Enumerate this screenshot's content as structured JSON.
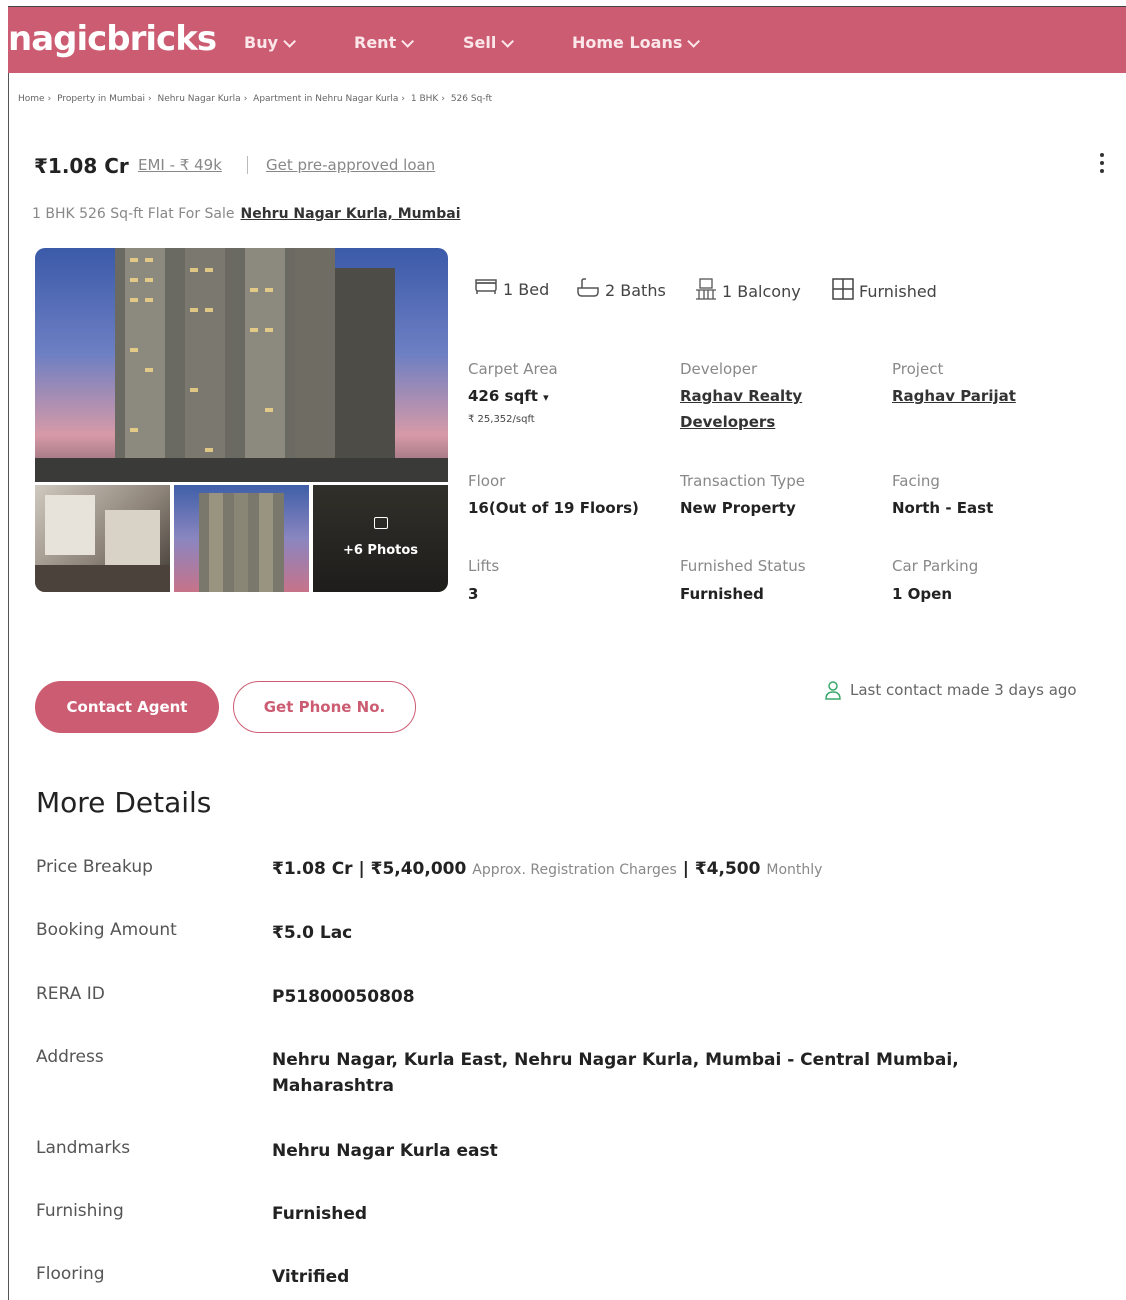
{
  "header": {
    "logo": "nagicbricks",
    "nav": [
      {
        "label": "Buy"
      },
      {
        "label": "Rent"
      },
      {
        "label": "Sell"
      },
      {
        "label": "Home Loans"
      }
    ],
    "brand_color": "#cc5c72"
  },
  "breadcrumb": [
    "Home",
    "Property in Mumbai",
    "Nehru Nagar Kurla",
    "Apartment in Nehru Nagar Kurla",
    "1 BHK",
    "526 Sq-ft"
  ],
  "listing": {
    "price": "₹1.08 Cr",
    "emi": "EMI - ₹ 49k",
    "preapproved": "Get pre-approved loan",
    "subtitle": "1 BHK 526 Sq-ft Flat For Sale",
    "location_link": "Nehru Nagar Kurla, Mumbai",
    "more_photos": "+6 Photos"
  },
  "amenities": [
    {
      "icon": "bed-icon",
      "label": "1 Bed"
    },
    {
      "icon": "bath-icon",
      "label": "2 Baths"
    },
    {
      "icon": "balcony-icon",
      "label": "1 Balcony"
    },
    {
      "icon": "furnished-icon",
      "label": "Furnished"
    }
  ],
  "specs": {
    "carpet_area": {
      "label": "Carpet Area",
      "value": "426 sqft",
      "sub": "₹ 25,352/sqft"
    },
    "developer": {
      "label": "Developer",
      "value_line1": "Raghav Realty",
      "value_line2": "Developers"
    },
    "project": {
      "label": "Project",
      "value": "Raghav Parijat"
    },
    "floor": {
      "label": "Floor",
      "value": "16(Out of 19 Floors)"
    },
    "transaction": {
      "label": "Transaction Type",
      "value": "New Property"
    },
    "facing": {
      "label": "Facing",
      "value": "North - East"
    },
    "lifts": {
      "label": "Lifts",
      "value": "3"
    },
    "furnished_status": {
      "label": "Furnished Status",
      "value": "Furnished"
    },
    "parking": {
      "label": "Car Parking",
      "value": "1 Open"
    }
  },
  "actions": {
    "contact_agent": "Contact Agent",
    "get_phone": "Get Phone No.",
    "last_contact": "Last contact made 3 days ago"
  },
  "more_details": {
    "title": "More Details",
    "price_breakup": {
      "label": "Price Breakup",
      "price": "₹1.08 Cr",
      "registration": "₹5,40,000",
      "registration_note": "Approx. Registration Charges",
      "maintenance": "₹4,500",
      "maintenance_note": "Monthly"
    },
    "rows": [
      {
        "label": "Booking Amount",
        "value": "₹5.0 Lac"
      },
      {
        "label": "RERA ID",
        "value": "P51800050808"
      },
      {
        "label": "Address",
        "value": "Nehru Nagar, Kurla East, Nehru Nagar Kurla, Mumbai - Central Mumbai, Maharashtra"
      },
      {
        "label": "Landmarks",
        "value": "Nehru Nagar Kurla east"
      },
      {
        "label": "Furnishing",
        "value": "Furnished"
      },
      {
        "label": "Flooring",
        "value": "Vitrified"
      }
    ]
  }
}
